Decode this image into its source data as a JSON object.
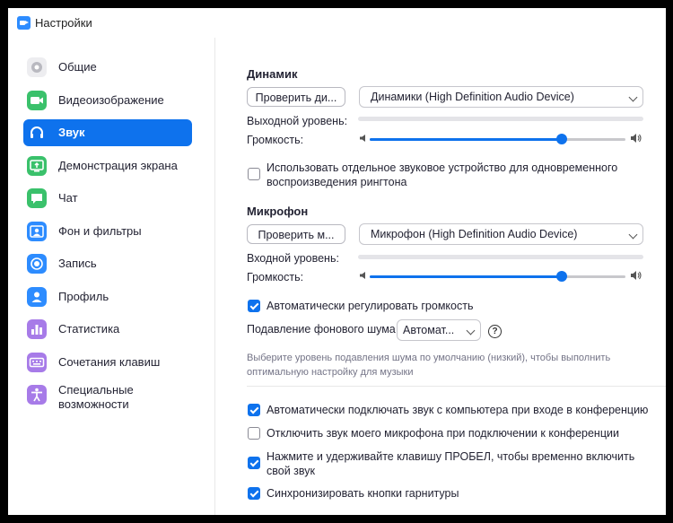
{
  "window": {
    "title": "Настройки",
    "app_icon": "zoom-video-icon"
  },
  "sidebar": {
    "items": [
      {
        "label": "Общие",
        "icon": "gear-icon",
        "color": "#b9b9c0"
      },
      {
        "label": "Видеоизображение",
        "icon": "video-camera-icon",
        "color": "#3ac16b"
      },
      {
        "label": "Звук",
        "icon": "headphones-icon",
        "color": "#0e72ed",
        "active": true
      },
      {
        "label": "Демонстрация экрана",
        "icon": "share-screen-icon",
        "color": "#3ac16b"
      },
      {
        "label": "Чат",
        "icon": "chat-bubble-icon",
        "color": "#3ac16b"
      },
      {
        "label": "Фон и фильтры",
        "icon": "background-person-icon",
        "color": "#2d8cff"
      },
      {
        "label": "Запись",
        "icon": "record-icon",
        "color": "#2d8cff"
      },
      {
        "label": "Профиль",
        "icon": "profile-icon",
        "color": "#2d8cff"
      },
      {
        "label": "Статистика",
        "icon": "statistics-bars-icon",
        "color": "#a77be8"
      },
      {
        "label": "Сочетания клавиш",
        "icon": "keyboard-icon",
        "color": "#a77be8"
      },
      {
        "label": "Специальные возможности",
        "icon": "accessibility-icon",
        "color": "#a77be8"
      }
    ]
  },
  "speaker": {
    "title": "Динамик",
    "test_button": "Проверить ди...",
    "device": "Динамики (High Definition Audio Device)",
    "output_level_label": "Выходной уровень:",
    "volume_label": "Громкость:",
    "volume": 0.75,
    "separate_device_label": "Использовать отдельное звуковое устройство для одновременного воспроизведения рингтона",
    "separate_device_checked": false
  },
  "microphone": {
    "title": "Микрофон",
    "test_button": "Проверить м...",
    "device": "Микрофон (High Definition Audio Device)",
    "input_level_label": "Входной уровень:",
    "volume_label": "Громкость:",
    "volume": 0.75,
    "auto_adjust_label": "Автоматически регулировать громкость",
    "auto_adjust_checked": true,
    "noise_label": "Подавление фонового шума",
    "noise_value": "Автомат...",
    "noise_help": "?",
    "noise_hint": "Выберите уровень подавления шума по умолчанию (низкий), чтобы выполнить оптимальную настройку для музыки"
  },
  "options": [
    {
      "label": "Автоматически подключать звук с компьютера при входе в конференцию",
      "checked": true
    },
    {
      "label": "Отключить звук моего микрофона при подключении к конференции",
      "checked": false
    },
    {
      "label": "Нажмите и удерживайте клавишу ПРОБЕЛ, чтобы временно включить свой звук",
      "checked": true
    },
    {
      "label": "Синхронизировать кнопки гарнитуры",
      "checked": true
    }
  ],
  "colors": {
    "accent": "#0e72ed"
  }
}
